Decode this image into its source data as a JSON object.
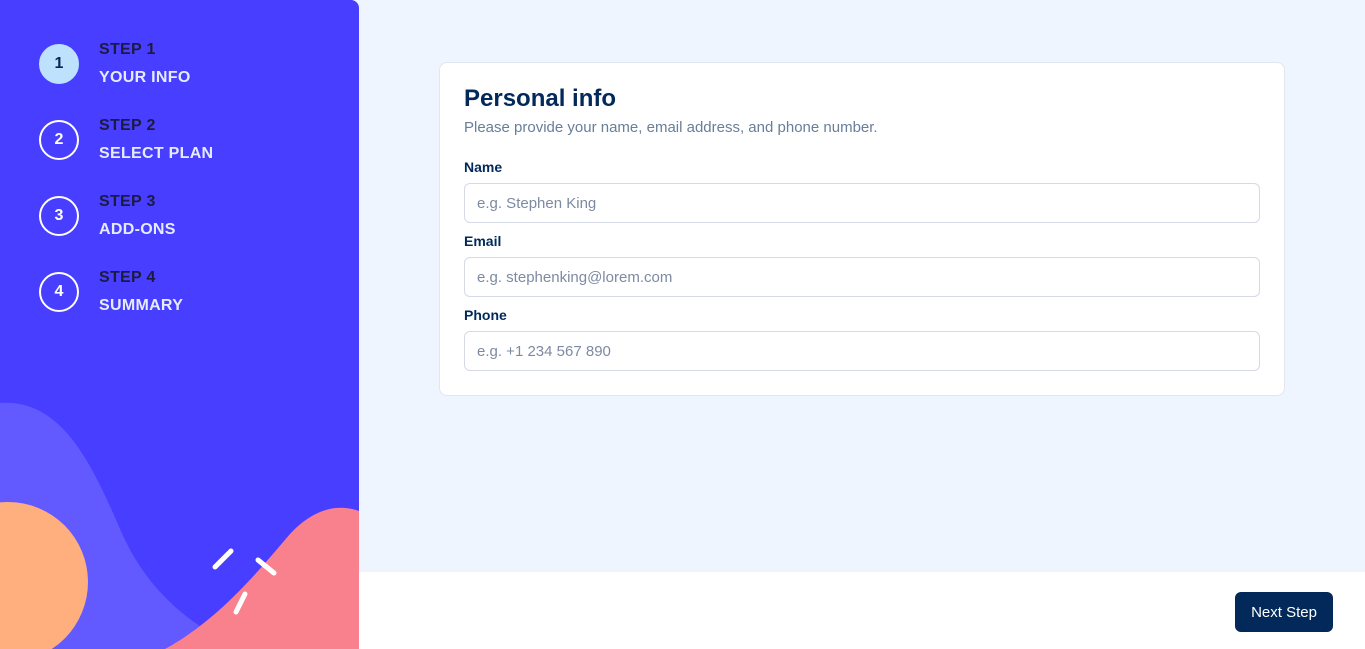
{
  "sidebar": {
    "steps": [
      {
        "number": "1",
        "label": "STEP 1",
        "title": "YOUR INFO",
        "active": true
      },
      {
        "number": "2",
        "label": "STEP 2",
        "title": "SELECT PLAN",
        "active": false
      },
      {
        "number": "3",
        "label": "STEP 3",
        "title": "ADD-ONS",
        "active": false
      },
      {
        "number": "4",
        "label": "STEP 4",
        "title": "SUMMARY",
        "active": false
      }
    ]
  },
  "form": {
    "title": "Personal info",
    "subtitle": "Please provide your name, email address, and phone number.",
    "fields": {
      "name": {
        "label": "Name",
        "placeholder": "e.g. Stephen King",
        "value": ""
      },
      "email": {
        "label": "Email",
        "placeholder": "e.g. stephenking@lorem.com",
        "value": ""
      },
      "phone": {
        "label": "Phone",
        "placeholder": "e.g. +1 234 567 890",
        "value": ""
      }
    }
  },
  "footer": {
    "next_label": "Next Step"
  },
  "colors": {
    "sidebar_bg": "#483eff",
    "active_step": "#bee2fd",
    "primary_dark": "#02295a",
    "page_bg": "#eff5ff"
  }
}
